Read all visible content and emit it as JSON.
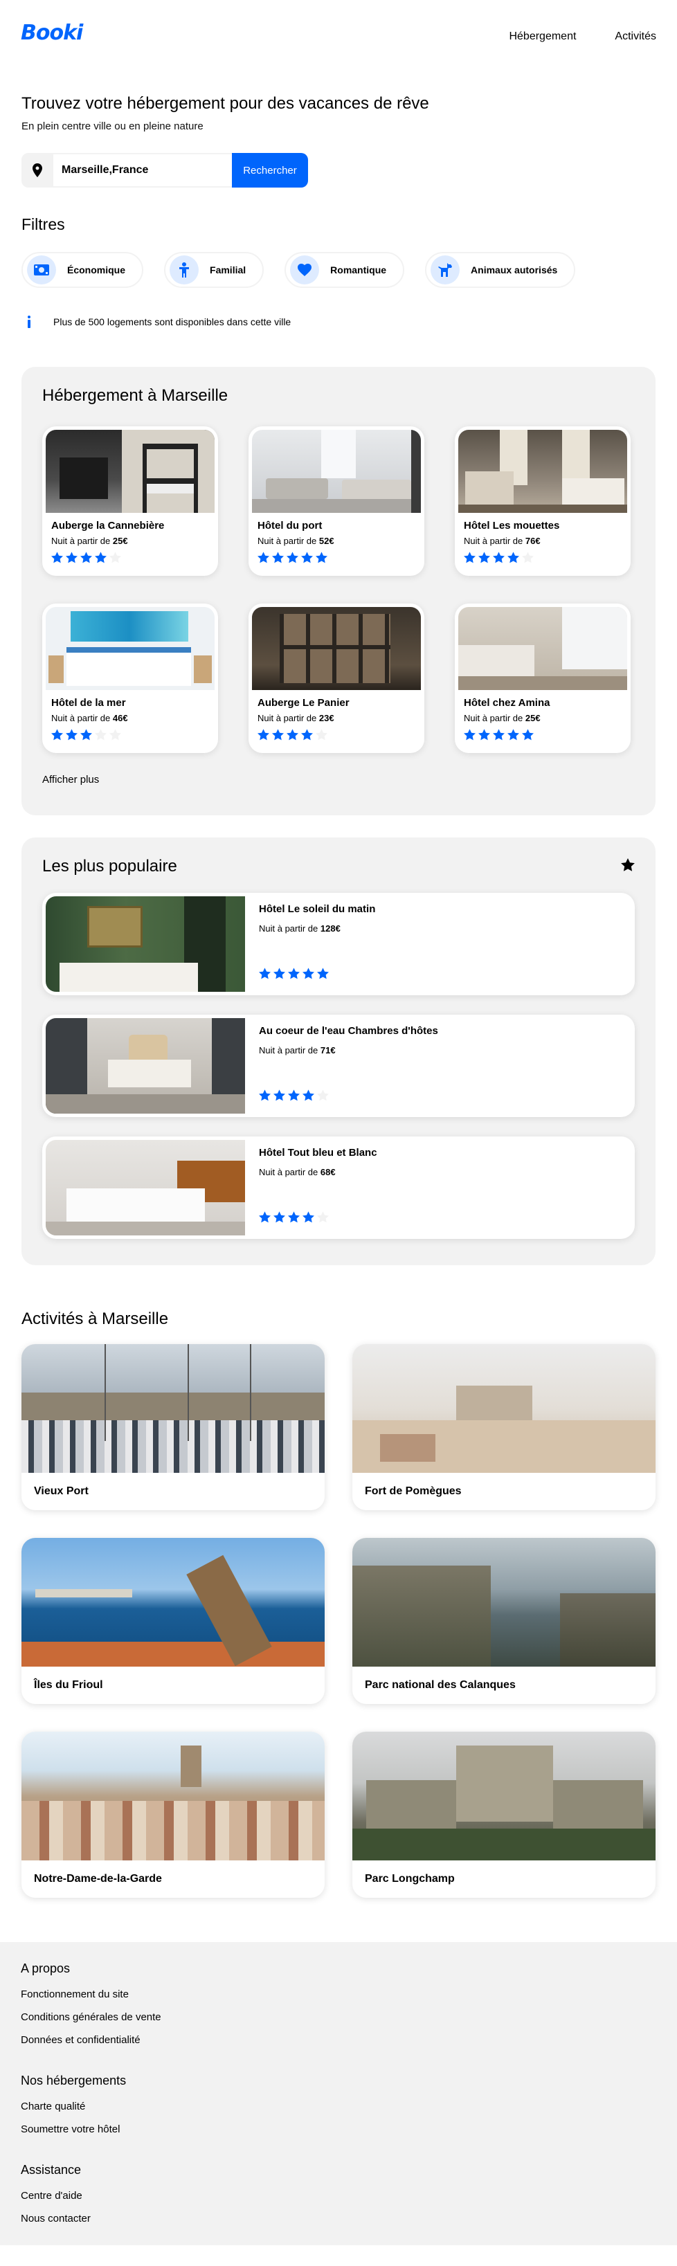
{
  "header": {
    "logo": "Booki",
    "nav": [
      "Hébergement",
      "Activités"
    ]
  },
  "hero": {
    "title": "Trouvez votre hébergement pour des vacances de rêve",
    "subtitle": "En plein centre ville ou en pleine nature",
    "search_value": "Marseille,France",
    "search_button": "Rechercher"
  },
  "filters": {
    "title": "Filtres",
    "items": [
      {
        "label": "Économique",
        "icon": "money-icon"
      },
      {
        "label": "Familial",
        "icon": "child-icon"
      },
      {
        "label": "Romantique",
        "icon": "heart-icon"
      },
      {
        "label": "Animaux autorisés",
        "icon": "dog-icon"
      }
    ],
    "info": "Plus de 500 logements sont disponibles dans cette ville"
  },
  "lodging": {
    "title": "Hébergement à Marseille",
    "price_prefix": "Nuit à partir de",
    "items": [
      {
        "name": "Auberge la Cannebière",
        "price": "25€",
        "rating": 4
      },
      {
        "name": "Hôtel du port",
        "price": "52€",
        "rating": 5
      },
      {
        "name": "Hôtel Les mouettes",
        "price": "76€",
        "rating": 4
      },
      {
        "name": "Hôtel de la mer",
        "price": "46€",
        "rating": 3
      },
      {
        "name": "Auberge Le Panier",
        "price": "23€",
        "rating": 4
      },
      {
        "name": "Hôtel chez Amina",
        "price": "25€",
        "rating": 5
      }
    ],
    "more": "Afficher plus"
  },
  "popular": {
    "title": "Les plus populaire",
    "price_prefix": "Nuit à partir de",
    "items": [
      {
        "name": "Hôtel Le soleil du matin",
        "price": "128€",
        "rating": 5
      },
      {
        "name": "Au coeur de l'eau Chambres d'hôtes",
        "price": "71€",
        "rating": 4
      },
      {
        "name": "Hôtel Tout bleu et Blanc",
        "price": "68€",
        "rating": 4
      }
    ]
  },
  "activities": {
    "title": "Activités à Marseille",
    "items": [
      "Vieux Port",
      "Fort de Pomègues",
      "Îles du Frioul",
      "Parc national des Calanques",
      "Notre-Dame-de-la-Garde",
      "Parc Longchamp"
    ]
  },
  "footer": {
    "sections": [
      {
        "title": "A propos",
        "links": [
          "Fonctionnement du site",
          "Conditions générales de vente",
          "Données et confidentialité"
        ]
      },
      {
        "title": "Nos hébergements",
        "links": [
          "Charte qualité",
          "Soumettre votre hôtel"
        ]
      },
      {
        "title": "Assistance",
        "links": [
          "Centre d'aide",
          "Nous contacter"
        ]
      }
    ]
  },
  "colors": {
    "primary": "#0065fc",
    "light_blue": "#deebff",
    "panel": "#f2f2f2",
    "star_empty": "#f2f2f2"
  }
}
